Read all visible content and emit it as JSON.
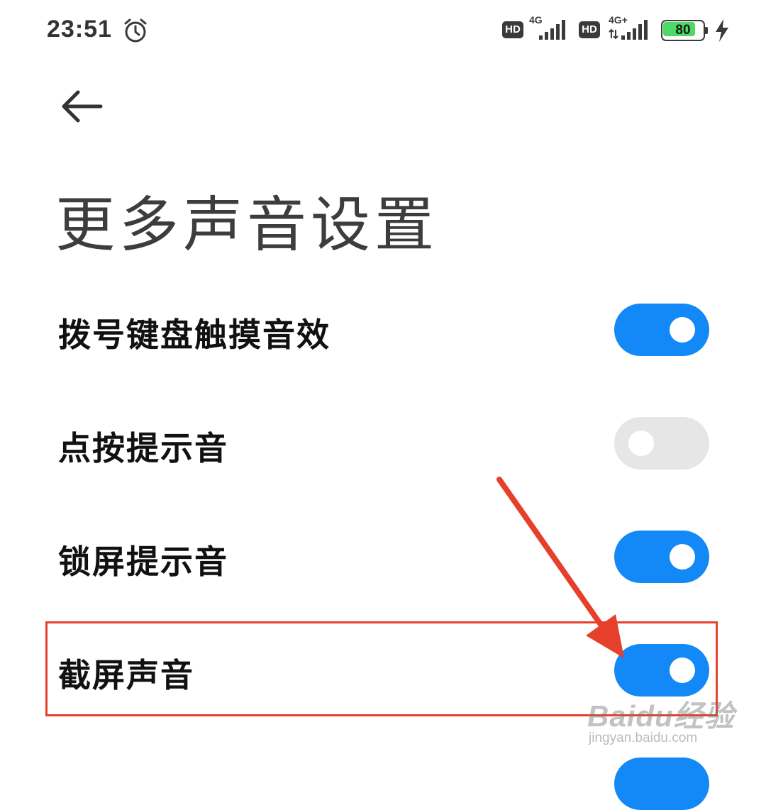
{
  "status_bar": {
    "time": "23:51",
    "alarm_icon": "alarm-clock-icon",
    "sim1": {
      "hd_label": "HD",
      "network": "4G"
    },
    "sim2": {
      "hd_label": "HD",
      "network": "4G+"
    },
    "battery": {
      "level_text": "80",
      "level": 0.8,
      "charging": true
    },
    "colors": {
      "battery_fill": "#4cd964",
      "icons": "#3a3a3a"
    }
  },
  "header": {
    "back_icon": "arrow-left-icon",
    "title": "更多声音设置"
  },
  "settings": {
    "items": [
      {
        "label": "拨号键盘触摸音效",
        "enabled": true
      },
      {
        "label": "点按提示音",
        "enabled": false
      },
      {
        "label": "锁屏提示音",
        "enabled": true
      },
      {
        "label": "截屏声音",
        "enabled": true,
        "highlighted": true
      }
    ],
    "colors": {
      "toggle_on": "#1289f7",
      "toggle_off": "#e6e6e6"
    }
  },
  "annotation": {
    "type": "red-arrow-and-box",
    "target": "截屏声音",
    "color": "#e6402c"
  },
  "watermark": {
    "logo_text": "Baidu经验",
    "url": "jingyan.baidu.com"
  }
}
